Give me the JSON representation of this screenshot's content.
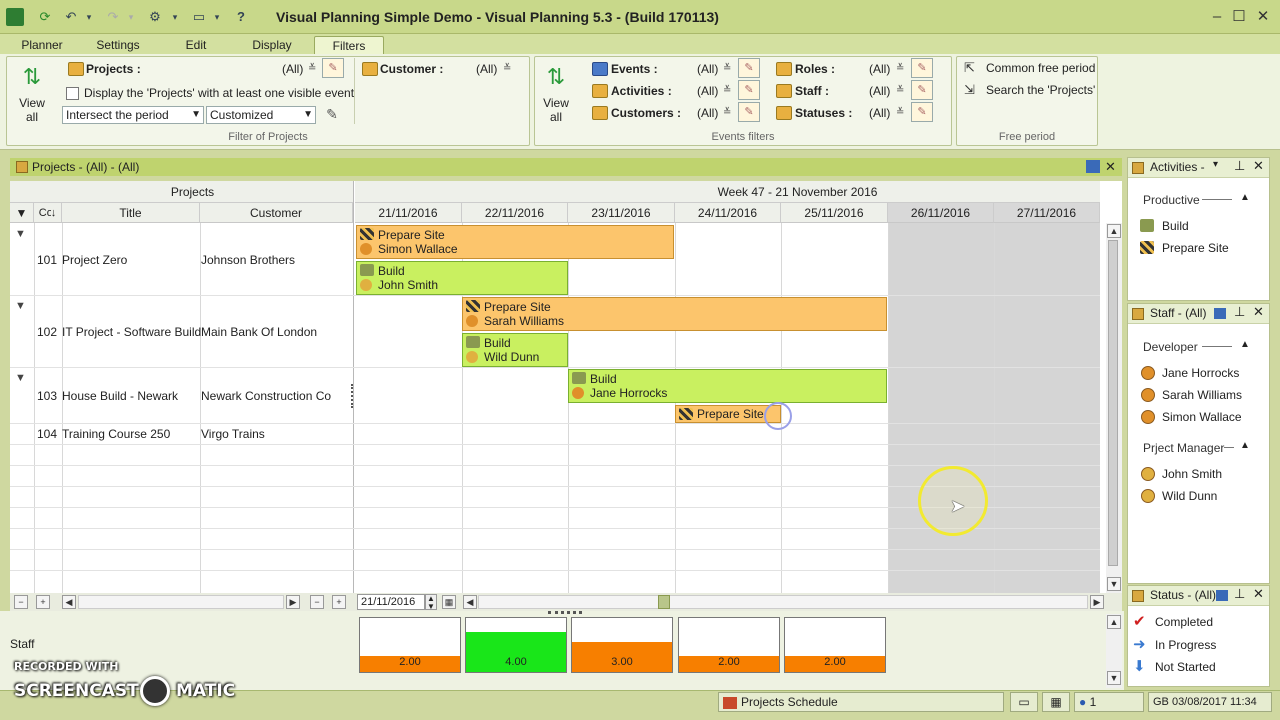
{
  "window": {
    "title": "Visual Planning Simple Demo - Visual Planning 5.3 - (Build 170113)"
  },
  "menu_tabs": [
    "Planner",
    "Settings",
    "Edit",
    "Display",
    "Filters"
  ],
  "ribbon": {
    "view_all_label_1": "View",
    "view_all_label_2": "all",
    "projects_label": "Projects :",
    "projects_value": "(All)",
    "customer_label": "Customer :",
    "customer_value": "(All)",
    "display_checkbox_label": "Display the 'Projects' with at least one visible event",
    "period_combo": "Intersect the period",
    "period_type_combo": "Customized",
    "filter_projects_group": "Filter of Projects",
    "events_label": "Events :",
    "events_value": "(All)",
    "activities_label": "Activities :",
    "activities_value": "(All)",
    "customers_label": "Customers :",
    "customers_value": "(All)",
    "roles_label": "Roles :",
    "roles_value": "(All)",
    "staff_label": "Staff :",
    "staff_value": "(All)",
    "statuses_label": "Statuses :",
    "statuses_value": "(All)",
    "events_filters_group": "Events filters",
    "common_free_period": "Common free period",
    "search_projects": "Search the 'Projects'",
    "free_period_group": "Free period"
  },
  "planner": {
    "panel_title": "Projects - (All) - (All)",
    "projects_header": "Projects",
    "col_code": "Code",
    "col_title": "Title",
    "col_customer": "Customer",
    "week_header": "Week 47 - 21 November 2016",
    "dates": [
      "21/11/2016",
      "22/11/2016",
      "23/11/2016",
      "24/11/2016",
      "25/11/2016",
      "26/11/2016",
      "27/11/2016"
    ],
    "rows": [
      {
        "code": "101",
        "title": "Project Zero",
        "customer": "Johnson Brothers"
      },
      {
        "code": "102",
        "title": "IT Project - Software Build",
        "customer": "Main Bank Of London"
      },
      {
        "code": "103",
        "title": "House Build - Newark",
        "customer": "Newark Construction Co"
      },
      {
        "code": "104",
        "title": "Training Course 250",
        "customer": "Virgo Trains"
      }
    ],
    "bars": [
      {
        "activity": "Prepare Site",
        "person": "Simon Wallace"
      },
      {
        "activity": "Build",
        "person": "John Smith"
      },
      {
        "activity": "Prepare Site",
        "person": "Sarah Williams"
      },
      {
        "activity": "Build",
        "person": "Wild Dunn"
      },
      {
        "activity": "Build",
        "person": "Jane Horrocks"
      },
      {
        "activity": "Prepare Site",
        "person": ""
      }
    ],
    "date_field": "21/11/2016"
  },
  "staff_chart": {
    "label": "Staff",
    "values": [
      "2.00",
      "4.00",
      "3.00",
      "2.00",
      "2.00"
    ],
    "fill_levels": [
      0.3,
      0.75,
      0.55,
      0.3,
      0.3
    ],
    "colors": [
      "#f77f00",
      "#19e619",
      "#f77f00",
      "#f77f00",
      "#f77f00"
    ]
  },
  "side": {
    "activities_title": "Activities - (A",
    "productive": "Productive",
    "activities": [
      "Build",
      "Prepare Site"
    ],
    "staff_title": "Staff - (All)",
    "developer": "Developer",
    "developers": [
      "Jane Horrocks",
      "Sarah Williams",
      "Simon Wallace"
    ],
    "project_manager": "Prject Manager",
    "managers": [
      "John Smith",
      "Wild Dunn"
    ],
    "status_title": "Status - (All)",
    "statuses": [
      "Completed",
      "In Progress",
      "Not Started"
    ]
  },
  "statusbar": {
    "view_name": "Projects Schedule",
    "users": "1",
    "datetime": "GB 03/08/2017 11:34"
  },
  "watermark": {
    "line1": "RECORDED WITH",
    "line2a": "SCREENCAST",
    "line2b": "MATIC"
  }
}
